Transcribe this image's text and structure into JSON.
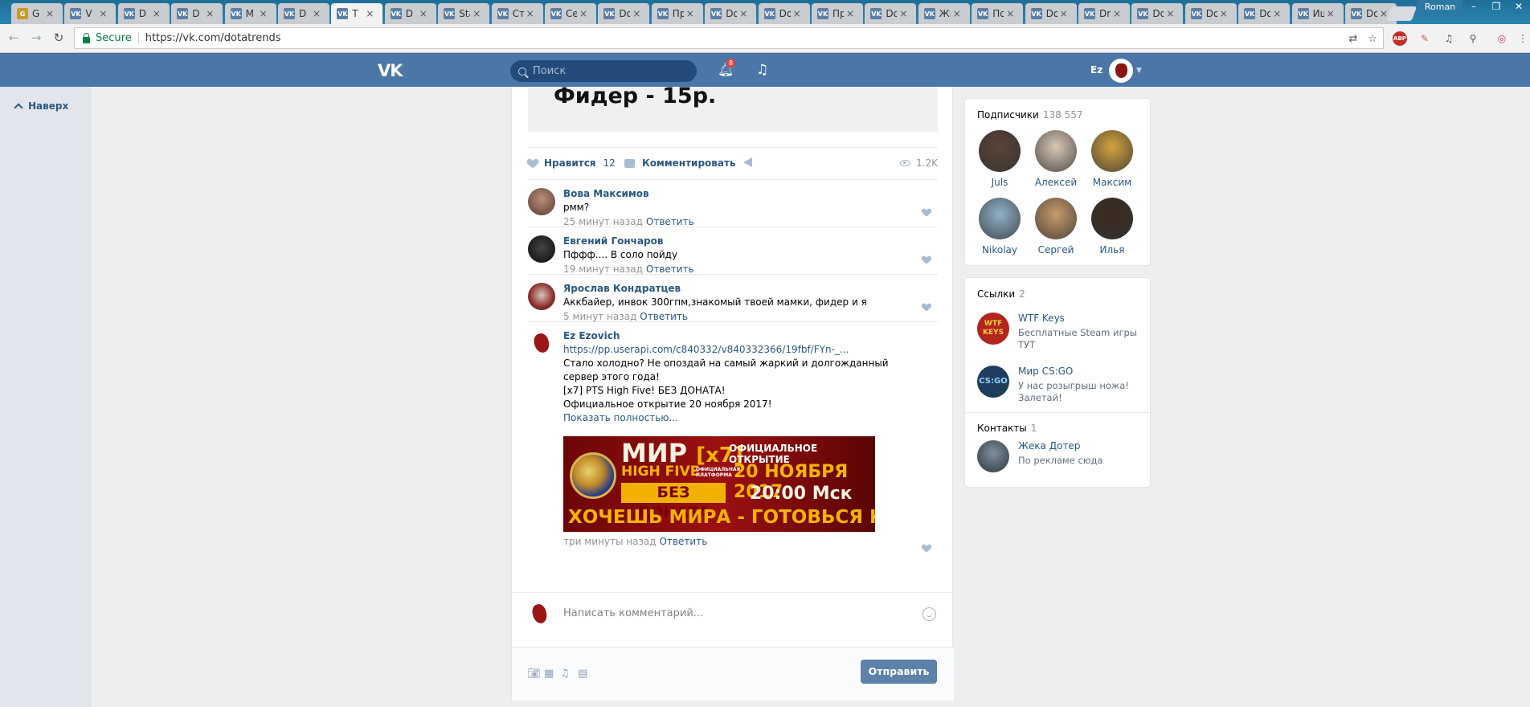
{
  "browser": {
    "tabs": [
      "G",
      "V",
      "D",
      "D",
      "M",
      "D",
      "T",
      "D",
      "Starl",
      "Студ",
      "Секр",
      "Dota",
      "Про",
      "Dota",
      "Dota",
      "Про",
      "Dota",
      "Жиз",
      "Под",
      "Dota",
      "Dnot",
      "Dota",
      "Dota",
      "Dota",
      "Ищу",
      "Dota"
    ],
    "active_tab_index": 6,
    "user": "Roman",
    "secure_label": "Secure",
    "url": "https://vk.com/dotatrends",
    "ext_badge": "1"
  },
  "vk_header": {
    "logo": "VK",
    "search_placeholder": "Поиск",
    "notif_count": "8",
    "user_short": "Ez"
  },
  "left_nav": {
    "up_label": "Наверх"
  },
  "post": {
    "image_text": "Фидер - 15р.",
    "like_label": "Нравится",
    "like_count": "12",
    "comment_label": "Комментировать",
    "views": "1.2K"
  },
  "replies": [
    {
      "author": "Вова Максимов",
      "text": "pмм?",
      "time": "25 минут назад",
      "reply_label": "Ответить"
    },
    {
      "author": "Евгений Гончаров",
      "text": "Пффф.... В соло пойду",
      "time": "19 минут назад",
      "reply_label": "Ответить"
    },
    {
      "author": "Ярослав Кондратцев",
      "text": "Аккбайер, инвок 300гпм,знакомый твоей мамки, фидер и я",
      "time": "5 минут назад",
      "reply_label": "Ответить"
    },
    {
      "author": "Ez Ezovich",
      "link": "https://pp.userapi.com/c840332/v840332366/19fbf/FYn-_...",
      "lines": [
        "Стало холодно? Не опоздай на самый жаркий и долгожданный сервер этого года!",
        "[x7] PTS High Five! БЕЗ ДОНАТА!",
        "Официальное открытие 20 ноября 2017!"
      ],
      "more": "Показать полностью...",
      "banner": {
        "title": "МИР",
        "title_tag": "[x7]",
        "sub": "HIGH FIVE",
        "platform": "ОФИЦИАЛЬНАЯ ПЛАТФОРМА",
        "nodonate": "БЕЗ ДОНАТА",
        "open": "ОФИЦИАЛЬНОЕ ОТКРЫТИЕ",
        "date": "20 НОЯБРЯ 2017",
        "time": "20:00 Мск",
        "slogan": "ХОЧЕШЬ МИРА - ГОТОВЬСЯ К ВОЙНЕ"
      },
      "time": "три минуты назад",
      "reply_label": "Ответить"
    }
  ],
  "comment_form": {
    "placeholder": "Написать комментарий...",
    "send_label": "Отправить"
  },
  "sidebar": {
    "subscribers_title": "Подписчики",
    "subscribers_count": "138 557",
    "subscribers": [
      {
        "name": "Juls",
        "color": "#5a4236"
      },
      {
        "name": "Алексей",
        "color": "#d9c8b4"
      },
      {
        "name": "Максим",
        "color": "#d4a23d"
      },
      {
        "name": "Nikolay",
        "color": "#8fb2c8"
      },
      {
        "name": "Сергей",
        "color": "#c99a6a"
      },
      {
        "name": "Илья",
        "color": "#3a2a20"
      }
    ],
    "links_title": "Ссылки",
    "links_count": "2",
    "links": [
      {
        "title": "WTF Keys",
        "desc": "Бесплатные Steam игры ТУТ",
        "color": "#b3261e",
        "badge": "WTF KEYS"
      },
      {
        "title": "Мир CS:GO",
        "desc": "У нас розыгрыш ножа! Залетай!",
        "color": "#1f3d5c",
        "badge": "CS:GO"
      }
    ],
    "contacts_title": "Контакты",
    "contacts_count": "1",
    "contact": {
      "name": "Жека Дотер",
      "desc": "По рекламе сюда",
      "color": "#3b4f5e"
    }
  }
}
